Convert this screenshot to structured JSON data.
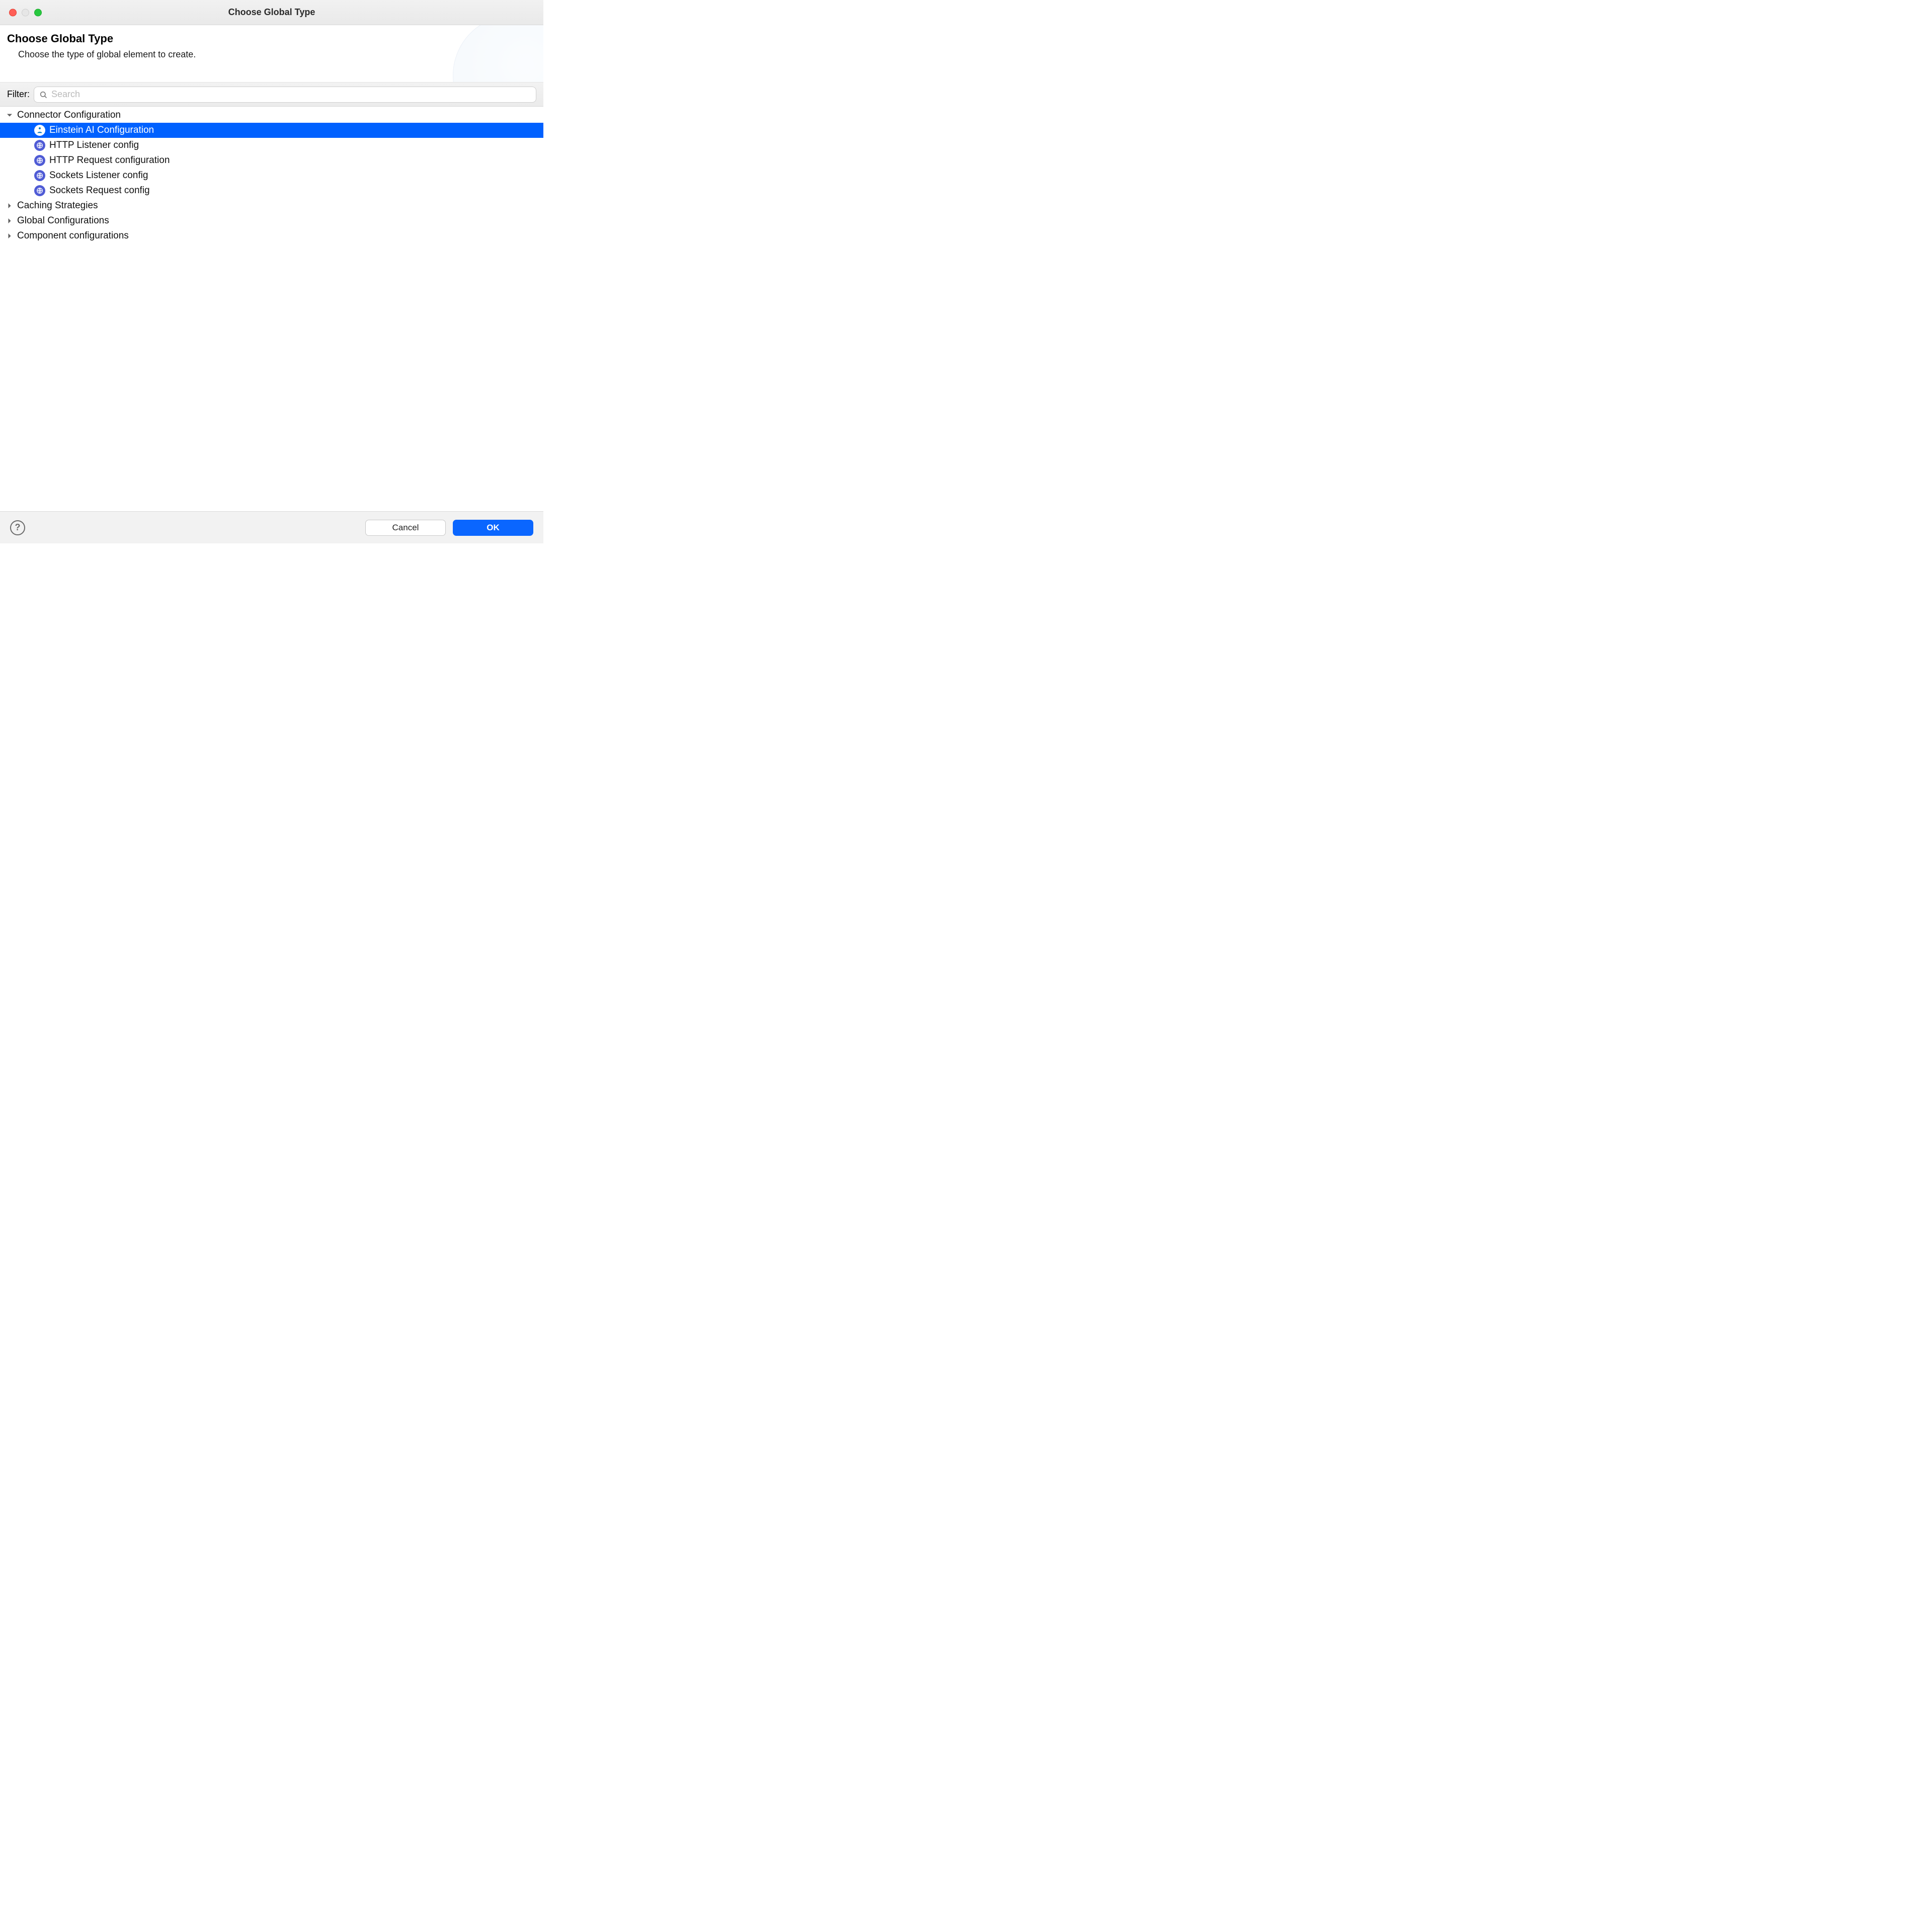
{
  "window": {
    "title": "Choose Global Type"
  },
  "header": {
    "heading": "Choose Global Type",
    "sub": "Choose the type of global element to create."
  },
  "filter": {
    "label": "Filter:",
    "placeholder": "Search",
    "value": ""
  },
  "tree": {
    "groups": [
      {
        "label": "Connector Configuration",
        "expanded": true,
        "children": [
          {
            "label": "Einstein AI Configuration",
            "icon": "ai",
            "selected": true
          },
          {
            "label": "HTTP Listener config",
            "icon": "globe",
            "selected": false
          },
          {
            "label": "HTTP Request configuration",
            "icon": "globe",
            "selected": false
          },
          {
            "label": "Sockets Listener config",
            "icon": "globe",
            "selected": false
          },
          {
            "label": "Sockets Request config",
            "icon": "globe",
            "selected": false
          }
        ]
      },
      {
        "label": "Caching Strategies",
        "expanded": false,
        "children": []
      },
      {
        "label": "Global Configurations",
        "expanded": false,
        "children": []
      },
      {
        "label": "Component configurations",
        "expanded": false,
        "children": []
      }
    ]
  },
  "footer": {
    "cancel": "Cancel",
    "ok": "OK"
  }
}
